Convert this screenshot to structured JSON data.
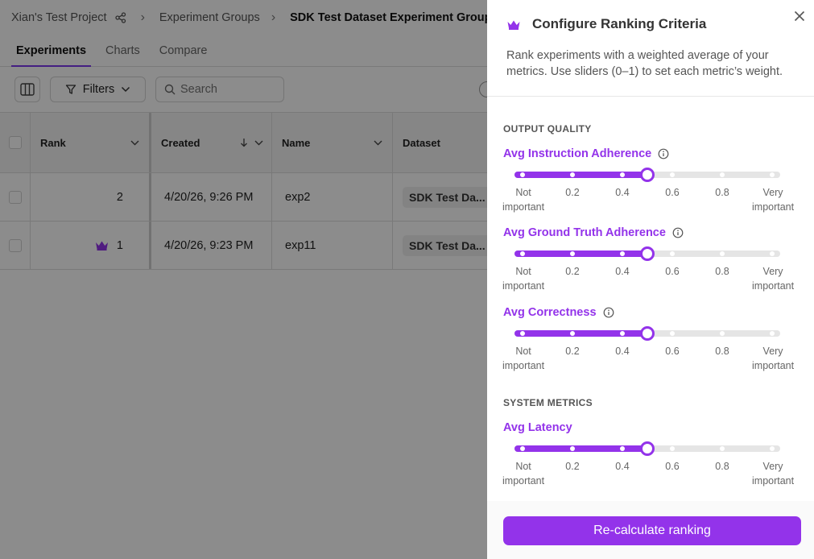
{
  "breadcrumb": {
    "project": "Xian's Test Project",
    "groups": "Experiment Groups",
    "current": "SDK Test Dataset Experiment Group"
  },
  "tabs": [
    "Experiments",
    "Charts",
    "Compare"
  ],
  "toolbar": {
    "filters_label": "Filters",
    "search_placeholder": "Search"
  },
  "table": {
    "columns": [
      "Rank",
      "Created",
      "Name",
      "Dataset"
    ],
    "rows": [
      {
        "rank": "2",
        "created": "4/20/26, 9:26 PM",
        "name": "exp2",
        "dataset": "SDK Test Da...",
        "crown": false
      },
      {
        "rank": "1",
        "created": "4/20/26, 9:23 PM",
        "name": "exp11",
        "dataset": "SDK Test Da...",
        "crown": true
      }
    ]
  },
  "drawer": {
    "title": "Configure Ranking Criteria",
    "description": "Rank experiments with a weighted average of your metrics. Use sliders (0–1) to set each metric’s weight.",
    "sections": [
      {
        "title": "OUTPUT QUALITY",
        "metrics": [
          {
            "label": "Avg Instruction Adherence",
            "value": 0.5,
            "info": true
          },
          {
            "label": "Avg Ground Truth Adherence",
            "value": 0.5,
            "info": true
          },
          {
            "label": "Avg Correctness",
            "value": 0.5,
            "info": true
          }
        ]
      },
      {
        "title": "SYSTEM METRICS",
        "metrics": [
          {
            "label": "Avg Latency",
            "value": 0.5,
            "info": false
          }
        ]
      }
    ],
    "tick_labels": {
      "min_line1": "Not",
      "min_line2": "important",
      "max_line1": "Very",
      "max_line2": "important",
      "values": [
        "0.2",
        "0.4",
        "0.6",
        "0.8"
      ]
    },
    "recalculate_label": "Re-calculate ranking"
  },
  "colors": {
    "accent": "#9333ea",
    "overlay": "#000000"
  }
}
